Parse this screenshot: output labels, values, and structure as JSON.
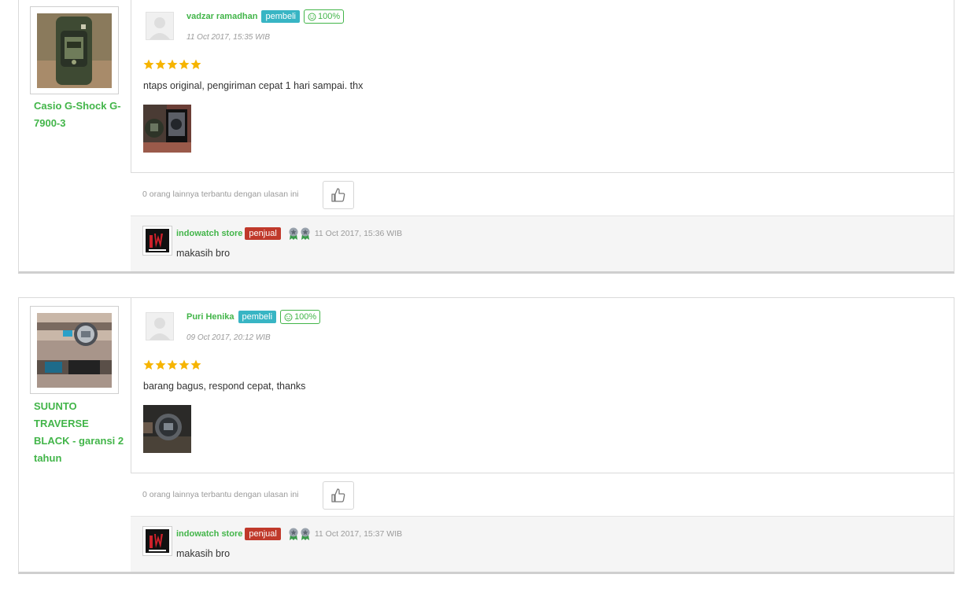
{
  "reviews": [
    {
      "product_name": "Casio G-Shock G-7900-3",
      "reviewer_name": "vadzar ramadhan",
      "buyer_badge": "pembeli",
      "reputation": "100%",
      "time": "11 Oct 2017, 15:35 WIB",
      "rating": 5,
      "text": "ntaps original, pengiriman cepat 1 hari sampai. thx",
      "helpful_text": "0 orang lainnya terbantu dengan ulasan ini",
      "seller": {
        "name": "indowatch store",
        "badge": "penjual",
        "time": "11 Oct 2017, 15:36 WIB",
        "reply": "makasih bro"
      }
    },
    {
      "product_name": "SUUNTO TRAVERSE BLACK - garansi 2 tahun",
      "reviewer_name": "Puri Henika",
      "buyer_badge": "pembeli",
      "reputation": "100%",
      "time": "09 Oct 2017, 20:12 WIB",
      "rating": 5,
      "text": "barang bagus, respond cepat, thanks",
      "helpful_text": "0 orang lainnya terbantu dengan ulasan ini",
      "seller": {
        "name": "indowatch store",
        "badge": "penjual",
        "time": "11 Oct 2017, 15:37 WIB",
        "reply": "makasih bro"
      }
    }
  ],
  "colors": {
    "link_green": "#42b549",
    "buyer_badge": "#38b5c4",
    "seller_badge": "#c0392b",
    "star": "#f6b400"
  },
  "icons": [
    "smiley-icon",
    "star-icon",
    "thumbs-up-icon",
    "medal-icon",
    "store-logo-icon",
    "user-avatar-icon"
  ]
}
